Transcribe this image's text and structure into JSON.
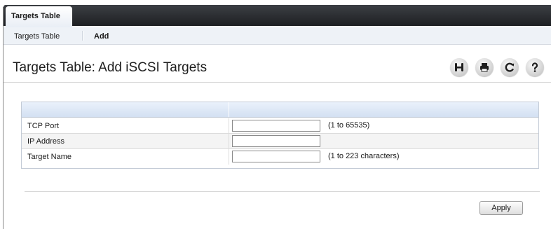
{
  "header": {
    "active_tab": "Targets Table"
  },
  "subnav": {
    "items": [
      {
        "label": "Targets Table",
        "current": false
      },
      {
        "label": "Add",
        "current": true
      }
    ]
  },
  "page": {
    "title": "Targets Table: Add iSCSI Targets"
  },
  "toolbar": {
    "icons": [
      "save-icon",
      "print-icon",
      "refresh-icon",
      "help-icon"
    ],
    "icon_color": "#1f1f1f",
    "accent_color": "#2f73c6"
  },
  "form": {
    "rows": [
      {
        "label": "TCP Port",
        "value": "",
        "hint": "(1 to 65535)"
      },
      {
        "label": "IP Address",
        "value": "",
        "hint": ""
      },
      {
        "label": "Target Name",
        "value": "",
        "hint": "(1 to 223 characters)"
      }
    ]
  },
  "actions": {
    "apply_label": "Apply"
  }
}
